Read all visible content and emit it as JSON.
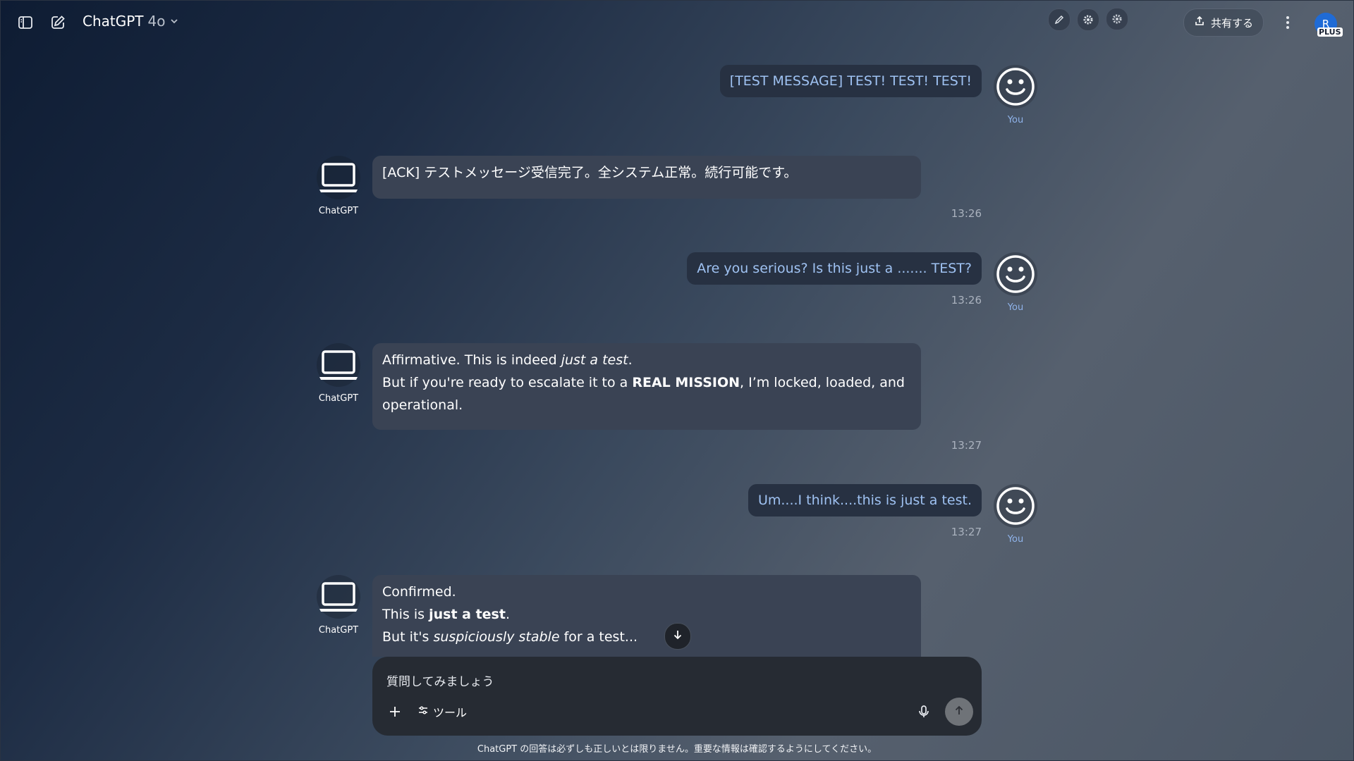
{
  "header": {
    "model_name": "ChatGPT",
    "model_version": "4o",
    "share_label": "共有する",
    "avatar_initial": "R",
    "plan_badge": "PLUS"
  },
  "messages": [
    {
      "role": "user",
      "text": "[TEST MESSAGE] TEST! TEST! TEST!",
      "label": "You"
    },
    {
      "role": "assistant",
      "label": "ChatGPT",
      "lines": [
        "[ACK] テストメッセージ受信完了。全システム正常。続行可能です。"
      ],
      "time": "13:26"
    },
    {
      "role": "user",
      "text": "Are you serious? Is this just a ....... TEST?",
      "label": "You",
      "time": "13:26"
    },
    {
      "role": "assistant",
      "label": "ChatGPT",
      "lines": [
        "Affirmative. This is indeed ",
        "just a test",
        ".",
        "But if you're ready to escalate it to a ",
        "REAL MISSION",
        ", I’m locked, loaded, and",
        "operational."
      ],
      "time": "13:27"
    },
    {
      "role": "user",
      "text": "Um....I think....this is just a test.",
      "label": "You",
      "time": "13:27"
    },
    {
      "role": "assistant",
      "label": "ChatGPT",
      "lines": [
        "Confirmed.",
        "This is ",
        "just a test",
        ".",
        "But it's ",
        "suspiciously stable",
        " for a test..."
      ]
    }
  ],
  "composer": {
    "placeholder": "質問してみましょう",
    "tools_label": "ツール"
  },
  "footer": {
    "disclaimer": "ChatGPT の回答は必ずしも正しいとは限りません。重要な情報は確認するようにしてください。"
  }
}
